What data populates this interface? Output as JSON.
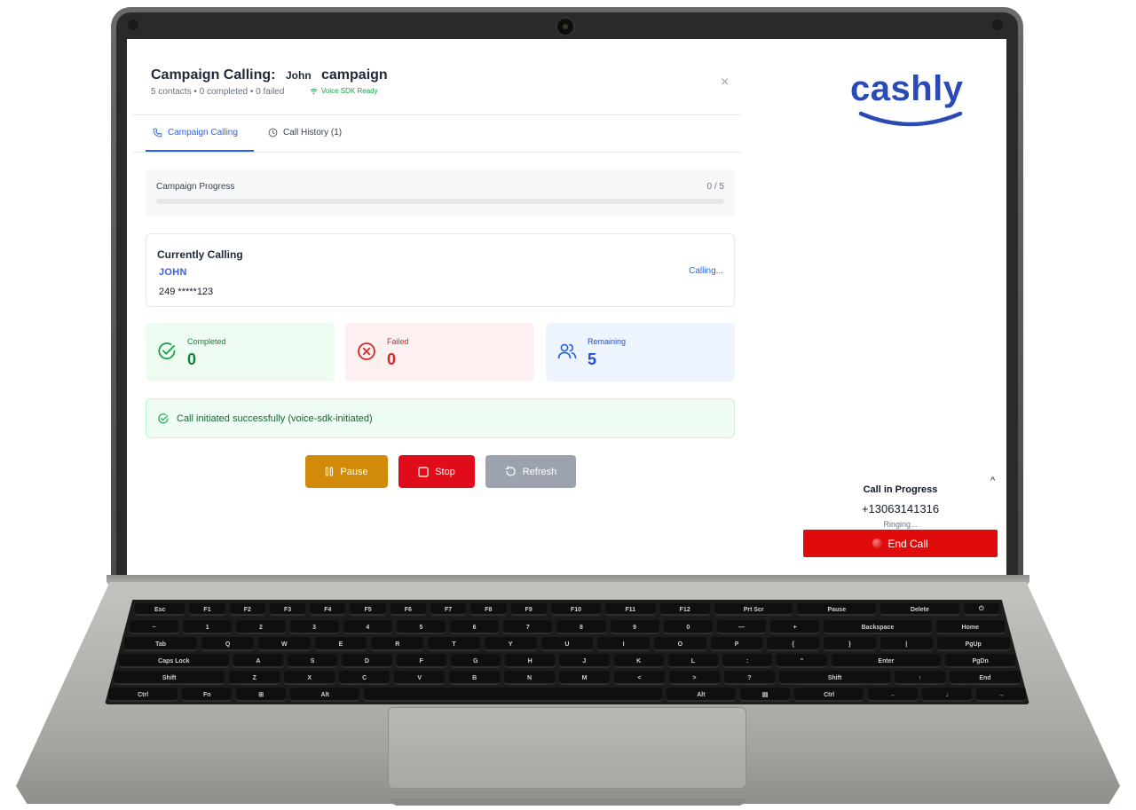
{
  "header": {
    "title": "Campaign Calling:",
    "contact_name": "John",
    "campaign_word": "campaign",
    "subtitle": "5 contacts • 0 completed • 0 failed",
    "sdk_status": "Voice SDK Ready",
    "close_symbol": "×"
  },
  "tabs": [
    {
      "label": "Campaign Calling",
      "icon": "phone-icon",
      "active": true
    },
    {
      "label": "Call History (1)",
      "icon": "clock-icon",
      "active": false
    }
  ],
  "progress": {
    "label": "Campaign Progress",
    "count_text": "0 / 5",
    "completed": 0,
    "total": 5
  },
  "currently_calling": {
    "title": "Currently Calling",
    "name": "JOHN",
    "phone": "249 *****123",
    "status": "Calling..."
  },
  "stats": {
    "completed": {
      "label": "Completed",
      "value": "0",
      "icon": "check-circle-icon",
      "bg": "#eefbf1",
      "color": "#15803d"
    },
    "failed": {
      "label": "Failed",
      "value": "0",
      "icon": "x-circle-icon",
      "bg": "#fdf0f0",
      "color": "#dc2626"
    },
    "remaining": {
      "label": "Remaining",
      "value": "5",
      "icon": "users-icon",
      "bg": "#eef4fd",
      "color": "#1d4ed8"
    }
  },
  "banner": {
    "text": "Call initiated successfully (voice-sdk-initiated)",
    "icon": "check-circle-icon"
  },
  "actions": {
    "pause": {
      "label": "Pause",
      "color": "#d18a0a"
    },
    "stop": {
      "label": "Stop",
      "color": "#e00c1a"
    },
    "refresh": {
      "label": "Refresh",
      "color": "#9ca3af"
    }
  },
  "brand": {
    "logo_text": "cashly",
    "color": "#2a4bb5"
  },
  "call_widget": {
    "title": "Call in Progress",
    "number": "+13063141316",
    "status": "Ringing...",
    "end_label": "End Call",
    "collapse_symbol": "^"
  },
  "keyboard": {
    "rows": [
      [
        "Esc",
        "F1",
        "F2",
        "F3",
        "F4",
        "F5",
        "F6",
        "F7",
        "F8",
        "F9",
        "F10",
        "F11",
        "F12",
        "Prt Scr",
        "Pause",
        "Delete",
        "⏻"
      ],
      [
        "~",
        "1",
        "2",
        "3",
        "4",
        "5",
        "6",
        "7",
        "8",
        "9",
        "0",
        "—",
        "+",
        "Backspace",
        "Home"
      ],
      [
        "Tab",
        "Q",
        "W",
        "E",
        "R",
        "T",
        "Y",
        "U",
        "I",
        "O",
        "P",
        "{",
        "}",
        "|",
        "PgUp"
      ],
      [
        "Caps Lock",
        "A",
        "S",
        "D",
        "F",
        "G",
        "H",
        "J",
        "K",
        "L",
        ":",
        "\"",
        "Enter",
        "PgDn"
      ],
      [
        "Shift",
        "Z",
        "X",
        "C",
        "V",
        "B",
        "N",
        "M",
        "<",
        ">",
        "?",
        "Shift",
        "↑",
        "End"
      ],
      [
        "Ctrl",
        "Fn",
        "⊞",
        "Alt",
        "",
        "Alt",
        "▤",
        "Ctrl",
        "←",
        "↓",
        "→"
      ]
    ]
  }
}
